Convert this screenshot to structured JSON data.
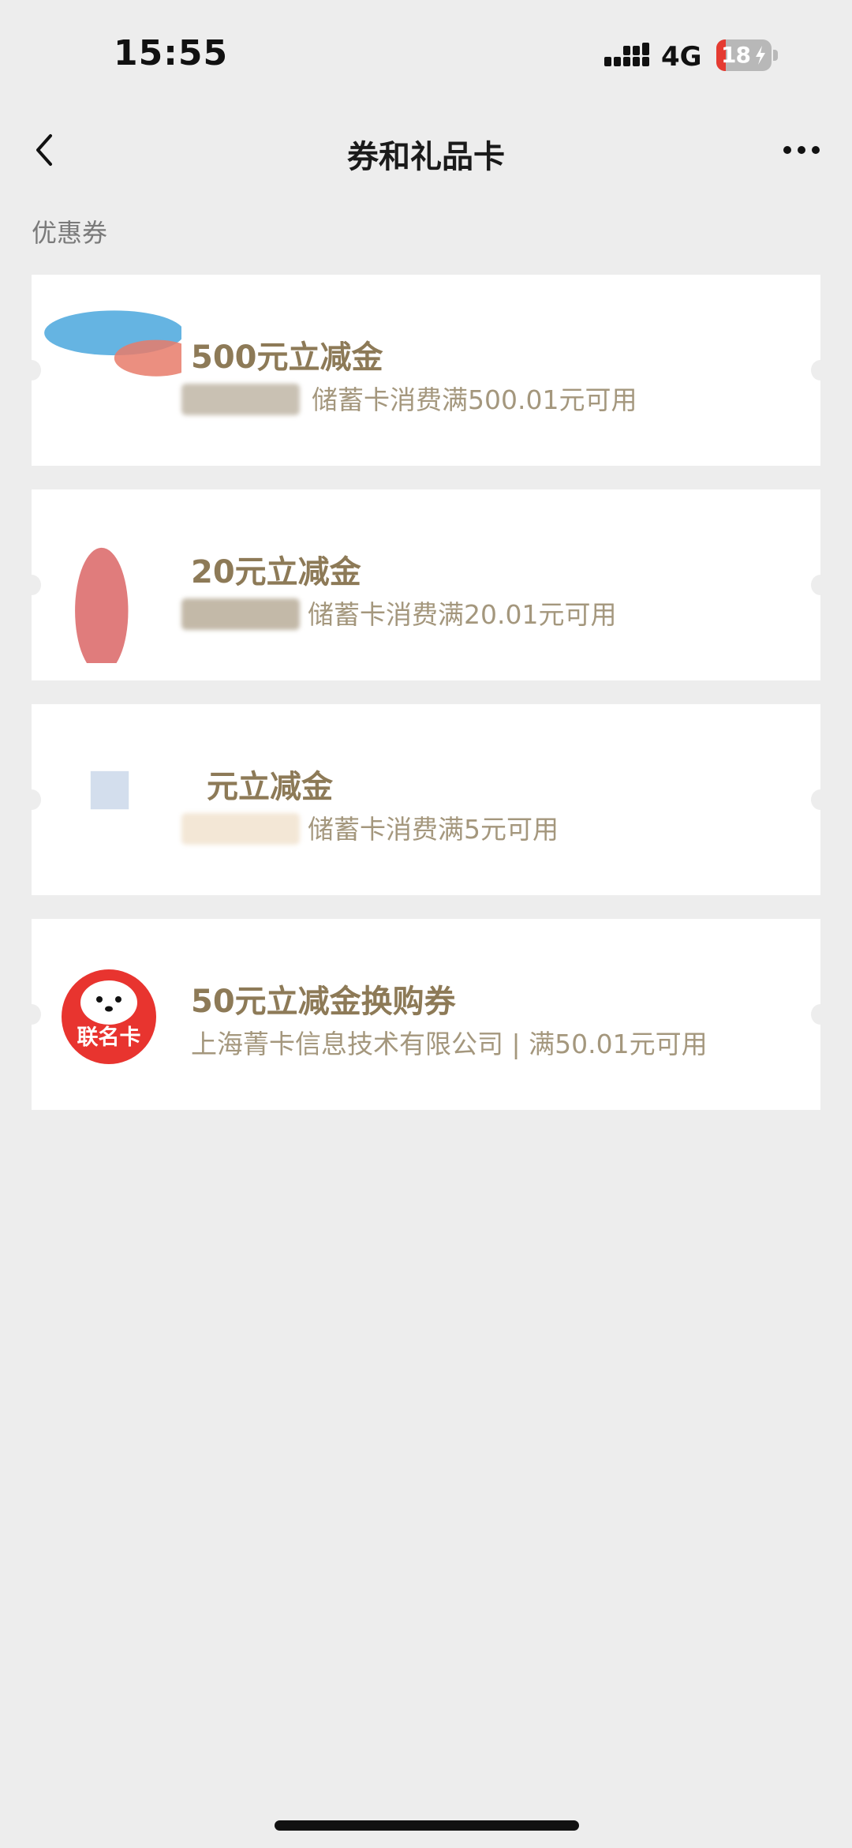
{
  "status_bar": {
    "time": "15:55",
    "network": "4G",
    "battery": "18",
    "signal_icon": "signal-bars-icon",
    "battery_icon": "battery-charging-icon"
  },
  "nav": {
    "title": "券和礼品卡",
    "back_icon": "chevron-left-icon",
    "more_icon": "more-dots-icon"
  },
  "section": {
    "title": "优惠券"
  },
  "coupons": [
    {
      "title": "500元立减金",
      "subtitle": "储蓄卡消费满500.01元可用"
    },
    {
      "title": "20元立减金",
      "subtitle": "储蓄卡消费满20.01元可用"
    },
    {
      "title": "元立减金",
      "subtitle": "储蓄卡消费满5元可用"
    },
    {
      "title": "50元立减金换购券",
      "subtitle": "上海菁卡信息技术有限公司 | 满50.01元可用",
      "logo_text": "联名卡"
    }
  ],
  "colors": {
    "background": "#ededed",
    "coupon_title": "#8d7a57",
    "coupon_subtitle": "#a4977d",
    "logo_red": "#e8342f"
  }
}
